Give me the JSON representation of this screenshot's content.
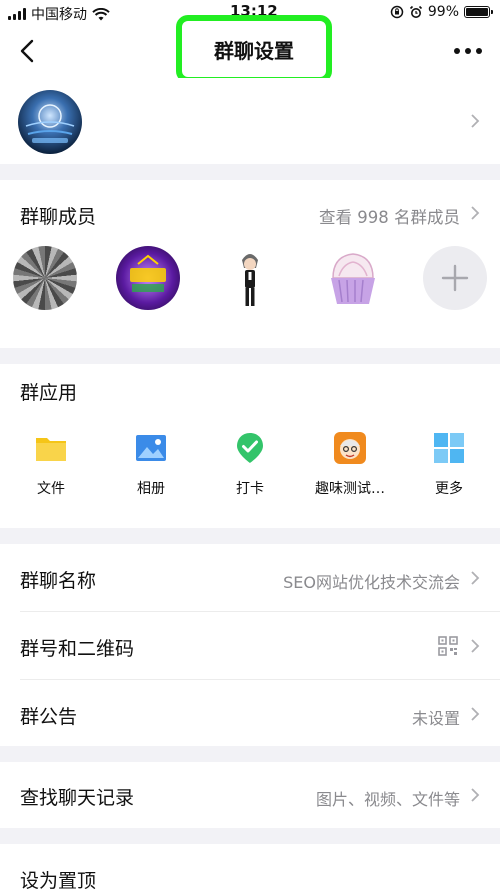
{
  "status_bar": {
    "carrier": "中国移动",
    "time": "13:12",
    "battery": "99%",
    "battery_level": 0.99
  },
  "nav": {
    "title": "群聊设置"
  },
  "members": {
    "label": "群聊成员",
    "view_all": "查看 998 名群成员"
  },
  "apps": {
    "label": "群应用",
    "items": [
      {
        "label": "文件",
        "icon": "folder-icon"
      },
      {
        "label": "相册",
        "icon": "photo-album-icon"
      },
      {
        "label": "打卡",
        "icon": "check-in-icon"
      },
      {
        "label": "趣味测试…",
        "icon": "fun-test-icon"
      },
      {
        "label": "更多",
        "icon": "grid-more-icon"
      }
    ]
  },
  "settings": {
    "name_label": "群聊名称",
    "name_value": "SEO网站优化技术交流会",
    "qr_label": "群号和二维码",
    "notice_label": "群公告",
    "notice_value": "未设置"
  },
  "history": {
    "label": "查找聊天记录",
    "value": "图片、视频、文件等"
  },
  "pin": {
    "label": "设为置顶"
  },
  "colors": {
    "highlight_border": "#22ee22",
    "folder": "#f5c518",
    "photo": "#3b8be8",
    "checkin": "#33c46a",
    "more": "#4fb6f2"
  }
}
